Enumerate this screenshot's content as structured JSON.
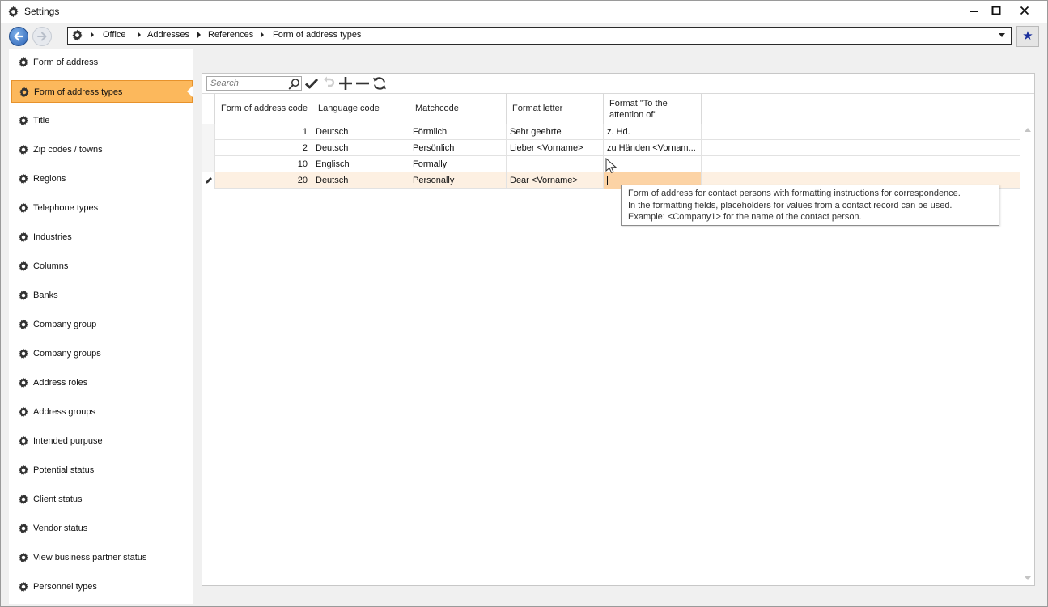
{
  "window": {
    "title": "Settings",
    "minimize": "_",
    "maximize": "☐",
    "close": "✕"
  },
  "nav": {
    "breadcrumb": [
      "Office",
      "Addresses",
      "References",
      "Form of address types"
    ],
    "favorite": "★"
  },
  "sidebar": {
    "items": [
      {
        "label": "Form of address",
        "active": false
      },
      {
        "label": "Form of address types",
        "active": true
      },
      {
        "label": "Title",
        "active": false
      },
      {
        "label": "Zip codes / towns",
        "active": false
      },
      {
        "label": "Regions",
        "active": false
      },
      {
        "label": "Telephone types",
        "active": false
      },
      {
        "label": "Industries",
        "active": false
      },
      {
        "label": "Columns",
        "active": false
      },
      {
        "label": "Banks",
        "active": false
      },
      {
        "label": "Company group",
        "active": false
      },
      {
        "label": "Company groups",
        "active": false
      },
      {
        "label": "Address roles",
        "active": false
      },
      {
        "label": "Address groups",
        "active": false
      },
      {
        "label": "Intended purpuse",
        "active": false
      },
      {
        "label": "Potential status",
        "active": false
      },
      {
        "label": "Client status",
        "active": false
      },
      {
        "label": "Vendor status",
        "active": false
      },
      {
        "label": "View business partner status",
        "active": false
      },
      {
        "label": "Personnel types",
        "active": false
      }
    ]
  },
  "toolbar": {
    "search_placeholder": "Search"
  },
  "grid": {
    "columns": [
      "Form of address code",
      "Language code",
      "Matchcode",
      "Format letter",
      "Format \"To the attention of\""
    ],
    "rows": [
      {
        "code": "1",
        "language": "Deutsch",
        "matchcode": "Förmlich",
        "letter": "Sehr geehrte",
        "attention": "z. Hd."
      },
      {
        "code": "2",
        "language": "Deutsch",
        "matchcode": "Persönlich",
        "letter": "Lieber <Vorname>",
        "attention": "zu Händen <Vornam..."
      },
      {
        "code": "10",
        "language": "Englisch",
        "matchcode": "Formally",
        "letter": "",
        "attention": ""
      },
      {
        "code": "20",
        "language": "Deutsch",
        "matchcode": "Personally",
        "letter": "Dear <Vorname>",
        "attention": ""
      }
    ]
  },
  "tooltip": {
    "lines": [
      "Form of address for contact persons with formatting instructions for correspondence.",
      "In the formatting fields, placeholders for values from a contact record can be used.",
      "Example: <Company1> for the name of the contact person."
    ]
  },
  "colors": {
    "active_item": "#fcb85c",
    "active_border": "#e7922b",
    "editing_row": "#fdf0e2",
    "editing_cell": "#fcd3a5",
    "favorite_star": "#1a2f9c"
  }
}
